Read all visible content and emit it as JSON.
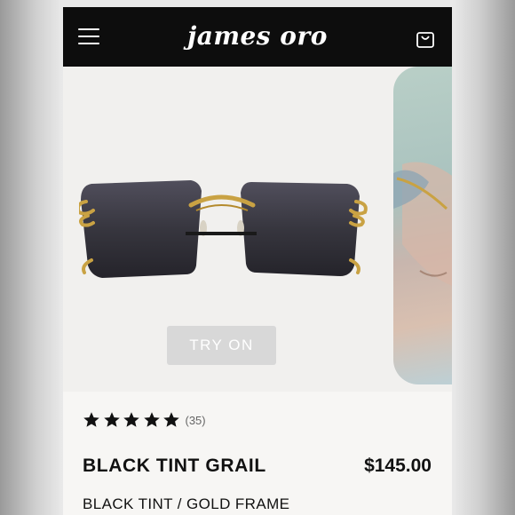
{
  "header": {
    "brand": "james oro",
    "menu_icon": "hamburger-menu-icon",
    "cart_icon": "shopping-bag-icon"
  },
  "hero": {
    "try_on_label": "TRY ON"
  },
  "product": {
    "rating": 5,
    "review_count": "(35)",
    "name": "BLACK TINT GRAIL",
    "price": "$145.00",
    "variant": "BLACK TINT / GOLD FRAME"
  },
  "colors": {
    "header_bg": "#0d0d0d",
    "lens": "#2e2d35",
    "frame_gold": "#c9a243",
    "try_on_bg": "#d8d8d8"
  }
}
